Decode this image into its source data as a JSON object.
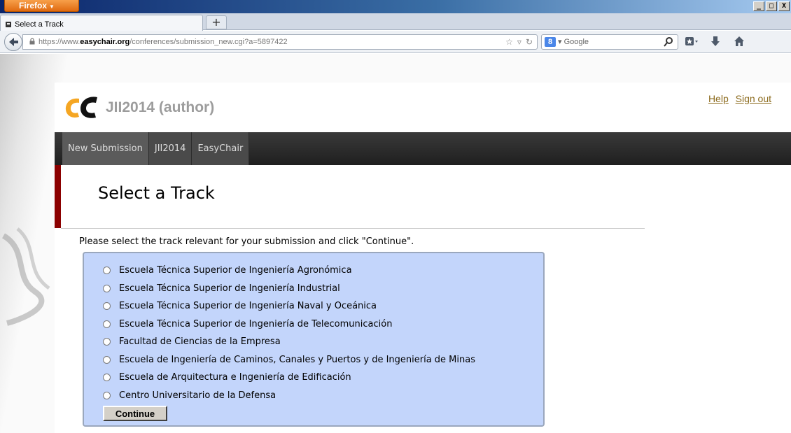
{
  "browser": {
    "menu_button": "Firefox",
    "tab_title": "Select a Track",
    "new_tab_label": "+",
    "url_prefix": "https://www.",
    "url_host": "easychair.org",
    "url_path": "/conferences/submission_new.cgi?a=5897422",
    "search_engine_label": "Google",
    "win_minimize": "_",
    "win_maximize": "□",
    "win_close": "X"
  },
  "header": {
    "app_title": "JII2014 (author)",
    "help_link": "Help",
    "signout_link": "Sign out"
  },
  "menu": {
    "items": [
      {
        "label": "New Submission"
      },
      {
        "label": "JII2014"
      },
      {
        "label": "EasyChair"
      }
    ]
  },
  "main": {
    "title": "Select a Track",
    "instruction": "Please select the track relevant for your submission and click \"Continue\".",
    "tracks": [
      {
        "label": "Escuela Técnica Superior de Ingeniería Agronómica"
      },
      {
        "label": "Escuela Técnica Superior de Ingeniería Industrial"
      },
      {
        "label": "Escuela Técnica Superior de Ingeniería Naval y Oceánica"
      },
      {
        "label": "Escuela Técnica Superior de Ingeniería de Telecomunicación"
      },
      {
        "label": "Facultad de Ciencias de la Empresa"
      },
      {
        "label": "Escuela de Ingeniería de Caminos, Canales y Puertos y de Ingeniería de Minas"
      },
      {
        "label": "Escuela de Arquitectura e Ingeniería de Edificación"
      },
      {
        "label": "Centro Universitario de la Defensa"
      }
    ],
    "continue_label": "Continue"
  },
  "colors": {
    "accent_red": "#8b0000",
    "track_box_bg": "#c3d5fb",
    "link": "#8b6a1c",
    "logo_orange": "#f5a623",
    "logo_black": "#111111"
  }
}
